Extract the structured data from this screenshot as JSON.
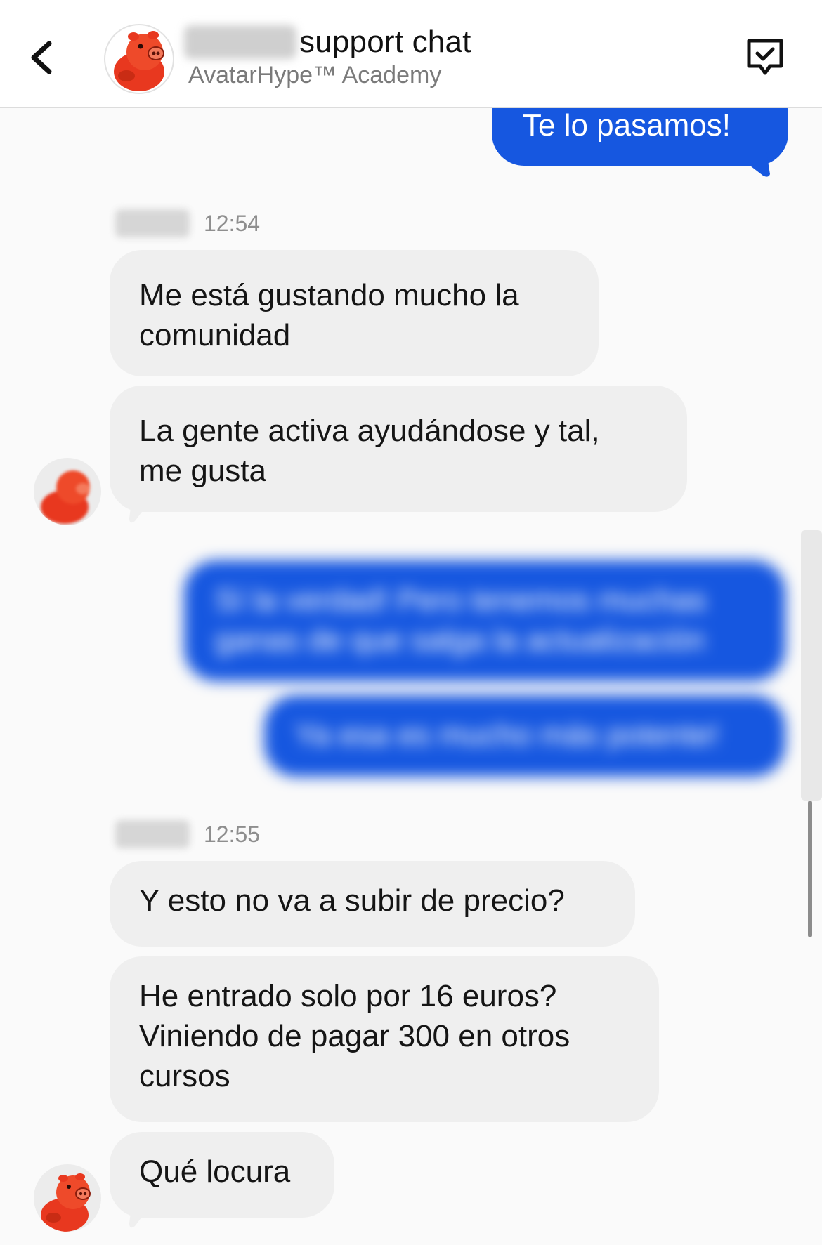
{
  "header": {
    "title": "support chat",
    "subtitle": "AvatarHype™ Academy",
    "back_icon": "chevron-left-icon",
    "action_icon": "message-check-icon",
    "avatar_icon": "red-pig-avatar-icon"
  },
  "messages": {
    "out_1": "Te lo pasamos!",
    "ts_1": "12:54",
    "in_1": "Me está gustando mucho la\ncomunidad",
    "in_2": "La gente activa ayudándose y tal,\nme gusta",
    "out_blur_1": "Sí la verdad! Pero tenemos muchas\nganas de que salga la actualización",
    "out_blur_2": "Ya esa es mucho más potente!",
    "ts_2": "12:55",
    "in_3": "Y esto no va a subir de precio?",
    "in_4": "He entrado solo por 16 euros?\nViniendo de pagar 300 en otros\ncursos",
    "in_5": "Qué locura"
  },
  "colors": {
    "outgoing_bubble": "#1657e0",
    "incoming_bubble": "#efefef",
    "avatar_red": "#e8381f"
  }
}
